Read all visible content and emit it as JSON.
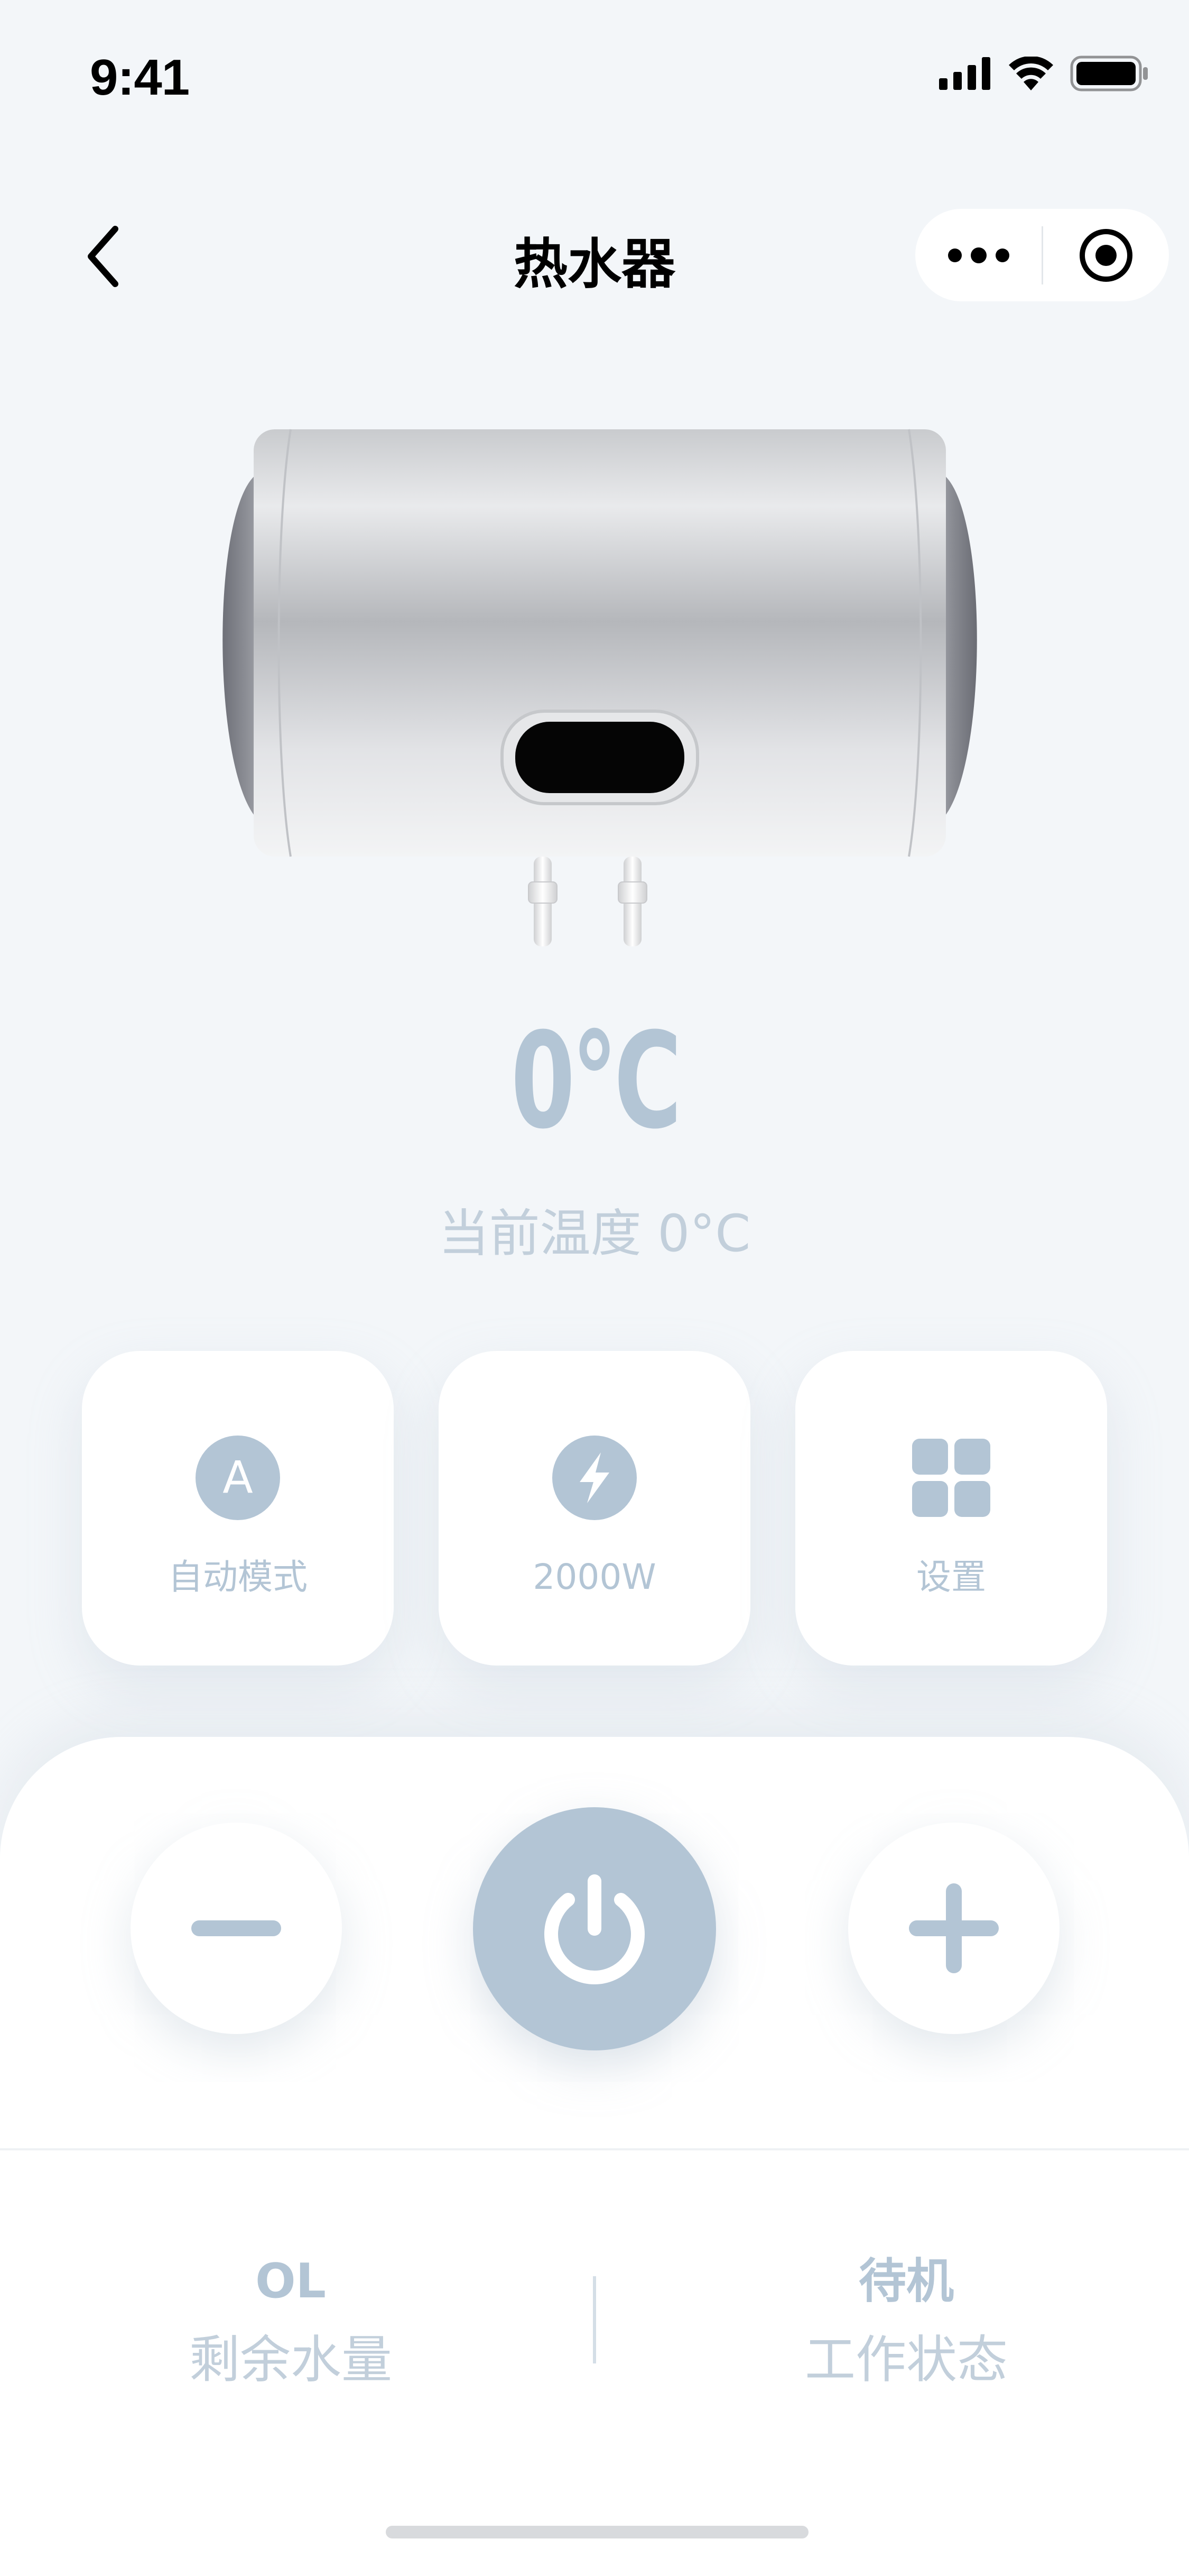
{
  "status_bar": {
    "time": "9:41",
    "icons": [
      "cellular-signal-icon",
      "wifi-icon",
      "battery-icon"
    ]
  },
  "nav": {
    "title": "热水器",
    "back_icon": "chevron-left-icon",
    "menu_icon": "more-dots-icon",
    "close_icon": "target-circle-icon"
  },
  "device": {
    "image": "water-heater-illustration"
  },
  "temperature": {
    "target": "0°C",
    "current_label": "当前温度 0°C"
  },
  "cards": [
    {
      "label": "自动模式",
      "icon": "auto-mode-icon",
      "icon_letter": "A"
    },
    {
      "label": "2000W",
      "icon": "lightning-icon"
    },
    {
      "label": "设置",
      "icon": "grid-settings-icon"
    }
  ],
  "controls": {
    "minus_icon": "minus-icon",
    "power_icon": "power-icon",
    "plus_icon": "plus-icon"
  },
  "info": {
    "water": {
      "value": "OL",
      "label": "剩余水量"
    },
    "status": {
      "value": "待机",
      "label": "工作状态"
    }
  },
  "colors": {
    "accent": "#b3c5d5",
    "muted_text": "#c2cfdb",
    "background": "#f3f6f9",
    "card": "#ffffff"
  }
}
